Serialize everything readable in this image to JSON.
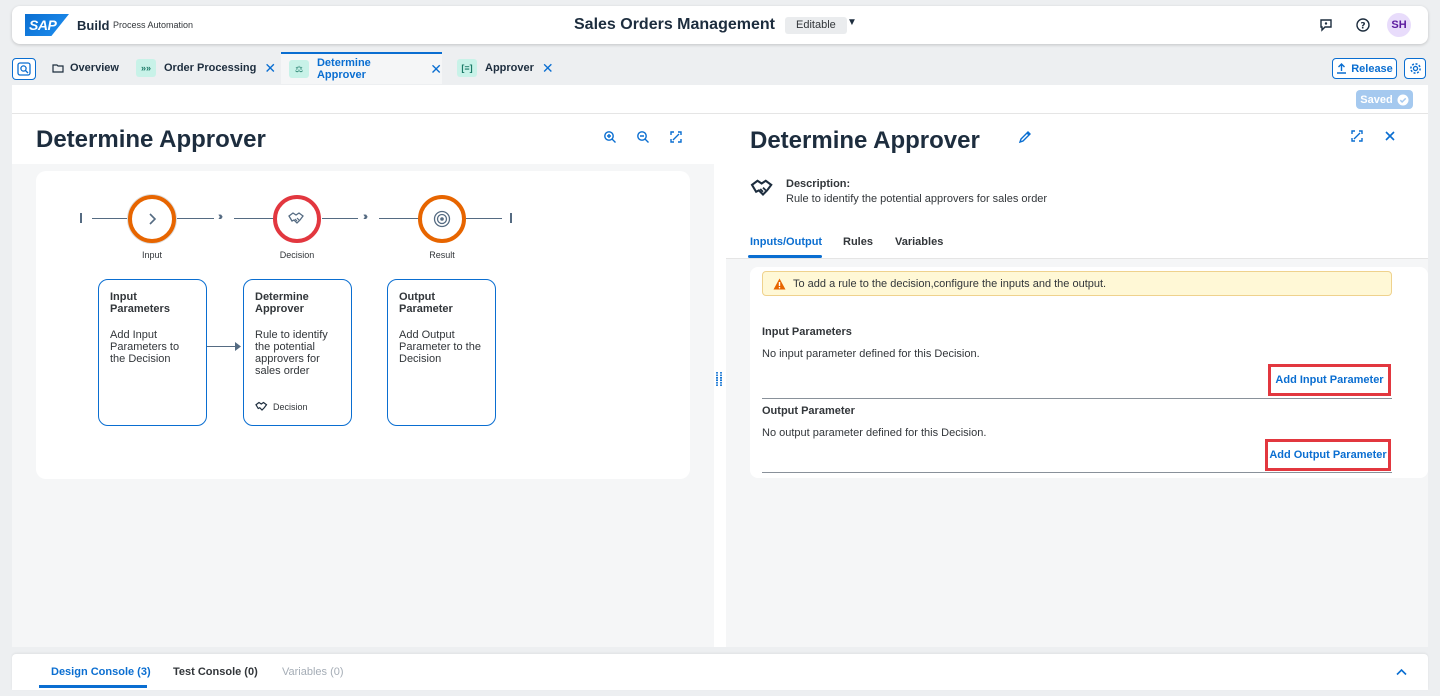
{
  "shell": {
    "brand": "Build",
    "brand_sub": "Process Automation",
    "title": "Sales Orders Management",
    "status": "Editable",
    "avatar": "SH"
  },
  "tabs": [
    {
      "label": "Overview"
    },
    {
      "label": "Order Processing"
    },
    {
      "label": "Determine Approver"
    },
    {
      "label": "Approver"
    }
  ],
  "toolbar": {
    "release_label": "Release",
    "saved_label": "Saved"
  },
  "left": {
    "title": "Determine Approver",
    "nodes": [
      "Input",
      "Decision",
      "Result"
    ],
    "cards": [
      {
        "title": "Input Parameters",
        "body": "Add Input Parameters to the Decision",
        "foot": ""
      },
      {
        "title": "Determine Approver",
        "body": "Rule to identify the potential approvers for sales order",
        "foot": "Decision"
      },
      {
        "title": "Output Parameter",
        "body": "Add Output Parameter to the Decision",
        "foot": ""
      }
    ]
  },
  "right": {
    "title": "Determine Approver",
    "description_label": "Description:",
    "description": "Rule to identify the potential approvers for sales order",
    "tabs": [
      "Inputs/Output",
      "Rules",
      "Variables"
    ],
    "warning": "To add a rule to the decision,configure the inputs and the output.",
    "input_section": {
      "title": "Input Parameters",
      "text": "No input parameter defined for this Decision.",
      "button": "Add Input Parameter"
    },
    "output_section": {
      "title": "Output Parameter",
      "text": "No output parameter defined for this Decision.",
      "button": "Add Output Parameter"
    }
  },
  "console": {
    "tabs": [
      "Design Console (3)",
      "Test Console (0)",
      "Variables (0)"
    ]
  },
  "colors": {
    "accent": "#0a6ed1",
    "node_orange": "#e76500",
    "node_red": "#e2373f",
    "highlight": "#e2373f"
  }
}
